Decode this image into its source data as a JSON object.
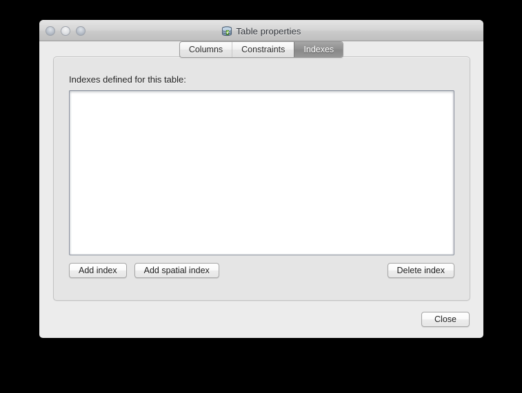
{
  "window": {
    "title": "Table properties",
    "title_icon": "database-table-icon",
    "traffic_lights": [
      {
        "name": "close-light",
        "label": "Close window"
      },
      {
        "name": "minimize-light",
        "label": "Minimize window"
      },
      {
        "name": "zoom-light",
        "label": "Zoom window"
      }
    ]
  },
  "tabs": [
    {
      "label": "Columns",
      "selected": false
    },
    {
      "label": "Constraints",
      "selected": false
    },
    {
      "label": "Indexes",
      "selected": true
    }
  ],
  "panel": {
    "label": "Indexes defined for this table:",
    "list_items": [],
    "buttons": {
      "add_index": "Add index",
      "add_spatial_index": "Add spatial index",
      "delete_index": "Delete index"
    }
  },
  "footer": {
    "close": "Close"
  },
  "colors": {
    "window_bg": "#ececec",
    "panel_bg": "#e5e5e5",
    "list_bg": "#ffffff",
    "list_border": "#8e94a0",
    "selected_tab_bg": "#8f8f8f",
    "selected_tab_text": "#ffffff",
    "desktop_bg": "#000000"
  }
}
